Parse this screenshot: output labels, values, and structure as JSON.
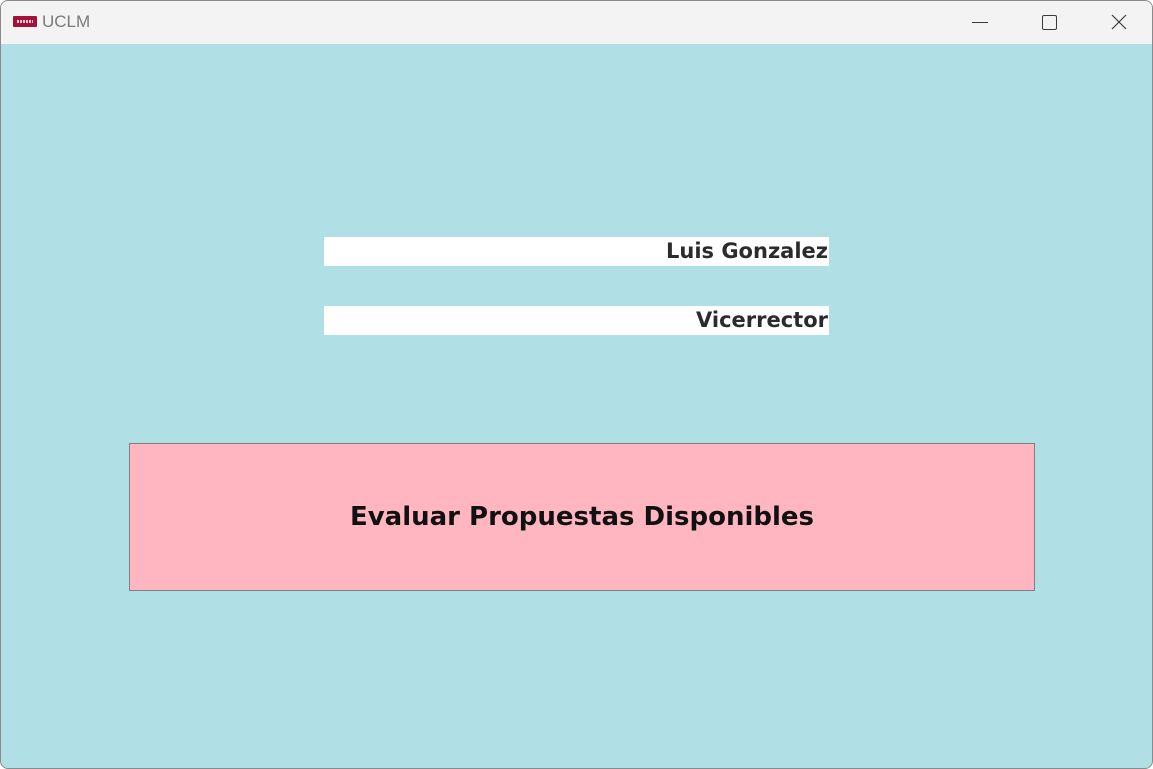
{
  "window": {
    "title": "UCLM",
    "app_icon": "uclm-logo-icon",
    "controls": {
      "minimize_icon": "minimize-icon",
      "maximize_icon": "maximize-icon",
      "close_icon": "close-icon"
    }
  },
  "user": {
    "name": "Luis Gonzalez",
    "role": "Vicerrector"
  },
  "actions": {
    "evaluate_label": "Evaluar Propuestas Disponibles"
  },
  "colors": {
    "background": "#b0dfe5",
    "button_background": "#ffb6c1",
    "field_background": "#ffffff",
    "logo": "#a3113a"
  }
}
